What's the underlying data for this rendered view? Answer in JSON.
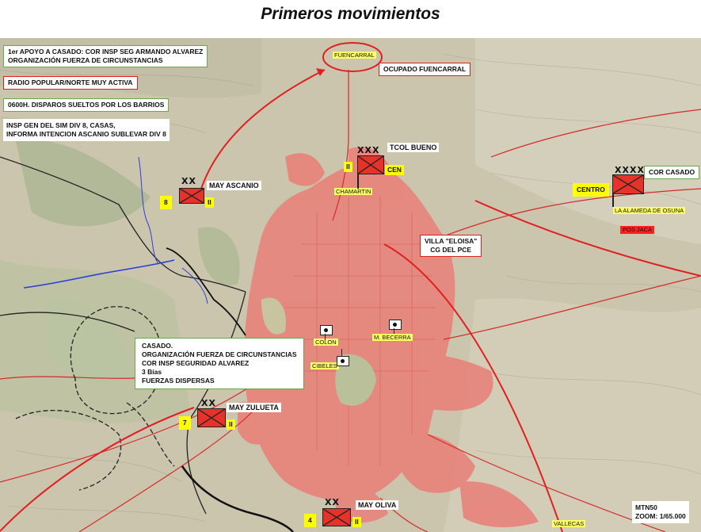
{
  "title": "Primeros  movimientos",
  "notes": {
    "apoyo_line1": "1er APOYO A CASADO: COR INSP SEG ARMANDO ALVAREZ",
    "apoyo_line2": "ORGANIZACIÓN FUERZA DE CIRCUNSTANCIAS",
    "radio": "RADIO POPULAR/NORTE  MUY ACTIVA",
    "disparos": "0600H. DISPAROS SUELTOS POR LOS BARRIOS",
    "insp_line1": "INSP GEN DEL SIM DIV 8, CASAS,",
    "insp_line2": " INFORMA INTENCION ASCANIO SUBLEVAR DIV 8",
    "ocupado": "OCUPADO FUENCARRAL",
    "villa_line1": "VILLA \"ELOISA\"",
    "villa_line2": "CG DEL  PCE",
    "casado_line1": "CASADO.",
    "casado_line2": "ORGANIZACIÓN FUERZA DE CIRCUNSTANCIAS",
    "casado_line3": "COR INSP SEGURIDAD  ALVAREZ",
    "casado_line4": "3 Bías",
    "casado_line5": "FUERZAS DISPERSAS",
    "scale_line1": "MTN50",
    "scale_line2": "ZOOM: 1/65.000"
  },
  "places": {
    "fuencarral": "FUENCARRAL",
    "chamartin": "CHAMARTIN",
    "colon": "COLON",
    "becerra": "M. BECERRA",
    "cibeles": "CIBELES",
    "alameda": "LA ALAMEDA DE OSUNA",
    "pos_jaca": "POS JACA",
    "vallecas": "VALLECAS"
  },
  "units": {
    "ascanio": {
      "name": "MAY ASCANIO",
      "number": "8",
      "echelon": "II",
      "symbol": "XX"
    },
    "bueno": {
      "name": "TCOL BUENO",
      "left": "II",
      "right": "CEN",
      "symbol": "XXX"
    },
    "casado": {
      "name": "COR CASADO",
      "left": "CENTRO",
      "symbol": "XXXX"
    },
    "zulueta": {
      "name": "MAY ZULUETA",
      "number": "7",
      "echelon": "II",
      "symbol": "XX"
    },
    "oliva": {
      "name": "MAY OLIVA",
      "number": "4",
      "echelon": "II",
      "symbol": "XX"
    }
  },
  "colors": {
    "accent_red": "#e5332a",
    "highlight_yellow": "#ffff00",
    "box_green": "#6aa84f",
    "urban": "#e8837b"
  }
}
